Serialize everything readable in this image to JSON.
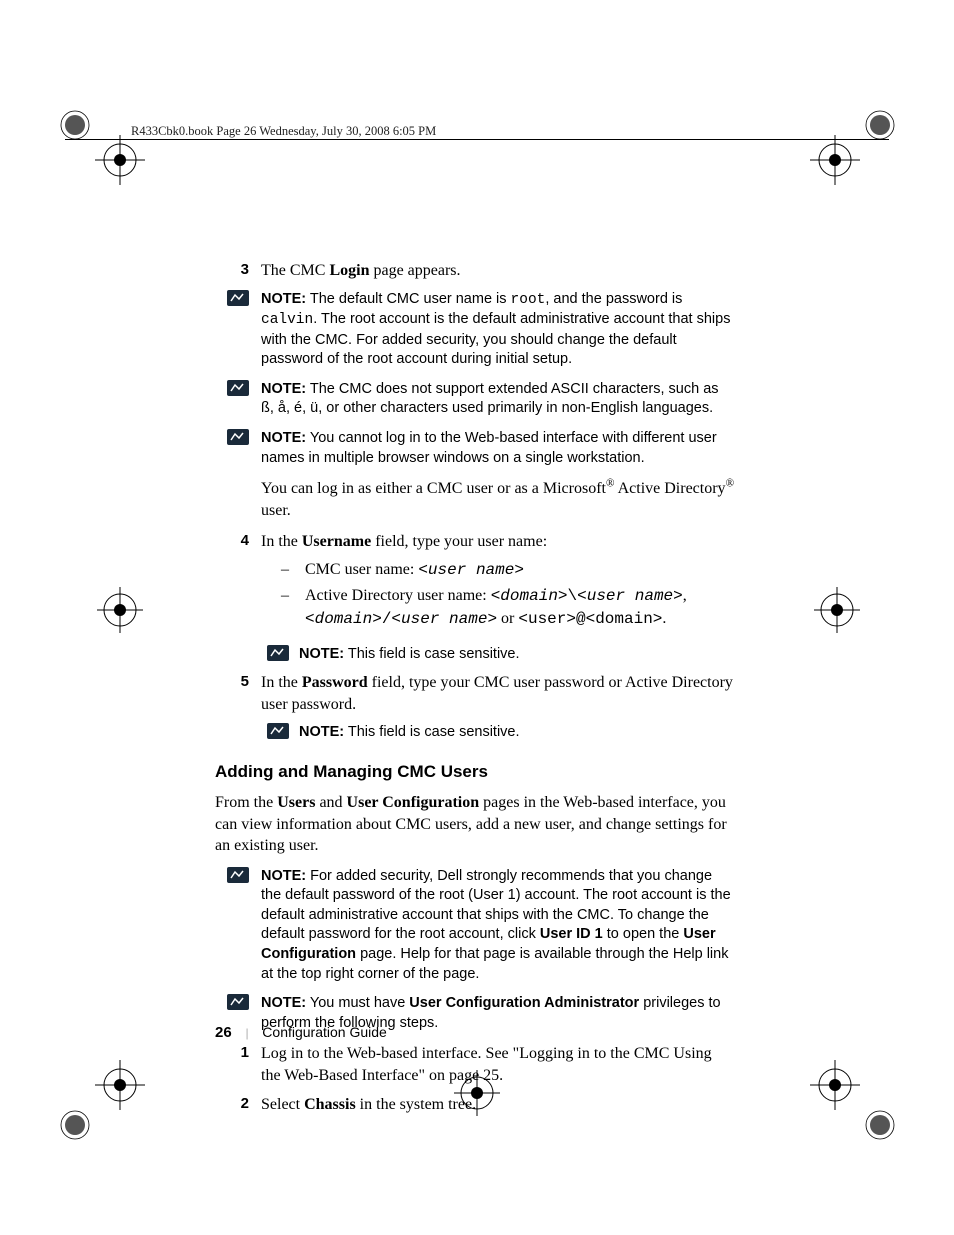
{
  "header": {
    "running_head": "R433Cbk0.book  Page 26  Wednesday, July 30, 2008  6:05 PM"
  },
  "step3": {
    "num": "3",
    "pre": "The CMC ",
    "bold": "Login",
    "post": " page appears."
  },
  "note1": {
    "label": "NOTE:",
    "pre": " The default CMC user name is ",
    "code1": "root",
    "mid": ", and the password is ",
    "code2": "calvin",
    "post": ". The root account is the default administrative account that ships with the CMC. For added security, you should change the default password of the root account during initial setup."
  },
  "note2": {
    "label": "NOTE:",
    "text": " The CMC does not support extended ASCII characters, such as ß, å, é, ü, or other characters used primarily in non-English languages."
  },
  "note3": {
    "label": "NOTE:",
    "text": " You cannot log in to the Web-based interface with different user names in multiple browser windows on a single workstation."
  },
  "para1": {
    "pre": "You can log in as either a CMC user or as a Microsoft",
    "sup1": "®",
    "mid": " Active Directory",
    "sup2": "®",
    "post": " user."
  },
  "step4": {
    "num": "4",
    "pre": "In the ",
    "bold": "Username",
    "post": " field, type your user name:"
  },
  "step4a": {
    "pre": "CMC user name: ",
    "code": "<user name>"
  },
  "step4b": {
    "pre": "Active Directory user name: ",
    "c1": "<domain>",
    "s1": "\\",
    "c2": "<user name>",
    "comma": ", ",
    "c3": "<domain>",
    "s2": "/",
    "c4": "<user name>",
    "or": " or ",
    "c5": "<user>",
    "at": "@",
    "c6": "<domain>",
    "dot": "."
  },
  "note4": {
    "label": "NOTE:",
    "text": " This field is case sensitive."
  },
  "step5": {
    "num": "5",
    "pre": "In the ",
    "bold": "Password",
    "post": " field, type your CMC user password or Active Directory user password."
  },
  "note5": {
    "label": "NOTE:",
    "text": " This field is case sensitive."
  },
  "sectionB": {
    "title": "Adding and Managing CMC Users"
  },
  "paraB": {
    "p1": "From the ",
    "b1": "Users",
    "p2": " and ",
    "b2": "User Configuration",
    "p3": " pages in the Web-based interface, you can view information about CMC users, add a new user, and change settings for an existing user."
  },
  "note6": {
    "label": "NOTE:",
    "p1": " For added security, Dell strongly recommends that you change the default password of the root (User 1) account. The root account is the default administrative account that ships with the CMC. To change the default password for the root account, click ",
    "b1": "User ID 1",
    "p2": " to open the ",
    "b2": "User Configuration",
    "p3": " page. Help for that page is available through the Help link at the top right corner of the page."
  },
  "note7": {
    "label": "NOTE:",
    "p1": " You must have ",
    "b1": "User Configuration Administrator",
    "p2": " privileges to perform the following steps."
  },
  "stepB1": {
    "num": "1",
    "text": "Log in to the Web-based interface. See \"Logging in to the CMC Using the Web-Based Interface\" on page 25."
  },
  "stepB2": {
    "num": "2",
    "pre": "Select ",
    "bold": "Chassis",
    "post": " in the system tree."
  },
  "footer": {
    "page": "26",
    "title": "Configuration Guide"
  }
}
